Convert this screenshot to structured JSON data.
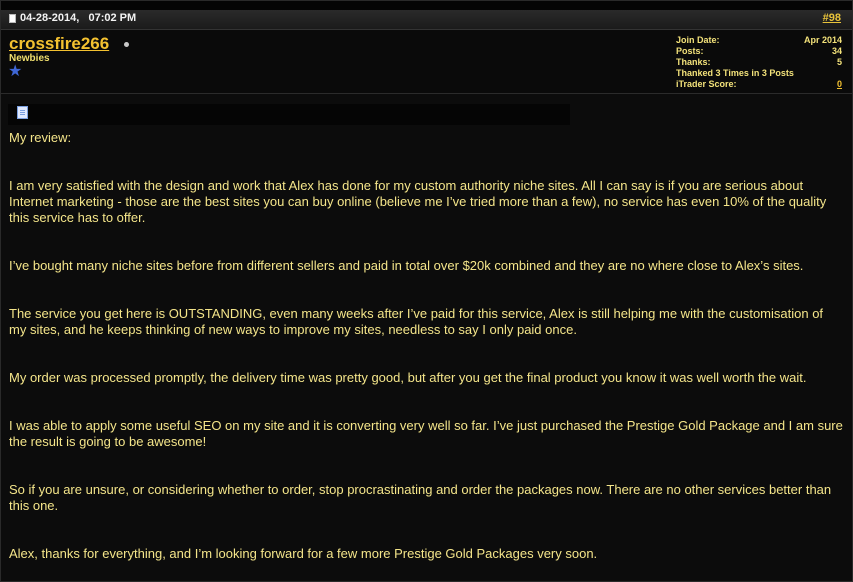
{
  "post": {
    "date": "04-28-2014,   07:02 PM",
    "number": "#98"
  },
  "user": {
    "name": "crossfire266",
    "title": "Newbies"
  },
  "stats": [
    {
      "label": "Join Date:",
      "value": "Apr 2014"
    },
    {
      "label": "Posts:",
      "value": "34"
    },
    {
      "label": "Thanks:",
      "value": "5"
    },
    {
      "label": "Thanked 3 Times in 3 Posts",
      "value": ""
    },
    {
      "label": "iTrader Score:",
      "value": "0"
    }
  ],
  "paragraphs": [
    "My review:",
    "I am very satisfied with the design and work that Alex has done for my custom authority niche sites. All I can say is if you are serious about Internet marketing - those are the best sites you can buy online (believe me I’ve tried more than a few), no service has even 10% of the quality this service has to offer.",
    "I’ve bought many niche sites before from different sellers and paid in total over $20k combined and they are no where close to Alex’s sites.",
    "The service you get here is OUTSTANDING, even many weeks after I’ve paid for this service, Alex is still helping me with the customisation of my sites, and he keeps thinking of new ways to improve my sites, needless to say I only paid once.",
    "My order was processed promptly, the delivery time was pretty good, but after you get the final product you know it was well worth the wait.",
    "I was able to apply some useful SEO on my site and it is converting very well so far. I’ve just purchased the Prestige Gold Package and I am sure the result is going to be awesome!",
    "So if you are unsure, or considering whether to order, stop procrastinating and order the packages now. There are no other services better than this one.",
    "Alex, thanks for everything, and I’m looking forward for a few more Prestige Gold Packages very soon."
  ],
  "colors": {
    "username": "#f3c130",
    "body_text": "#f4e58a",
    "background": "#0b0b0b",
    "rep_star": "#3f67d6"
  },
  "icons": [
    "post-icon",
    "online-status-icon",
    "reputation-star-icon",
    "message-icon"
  ]
}
